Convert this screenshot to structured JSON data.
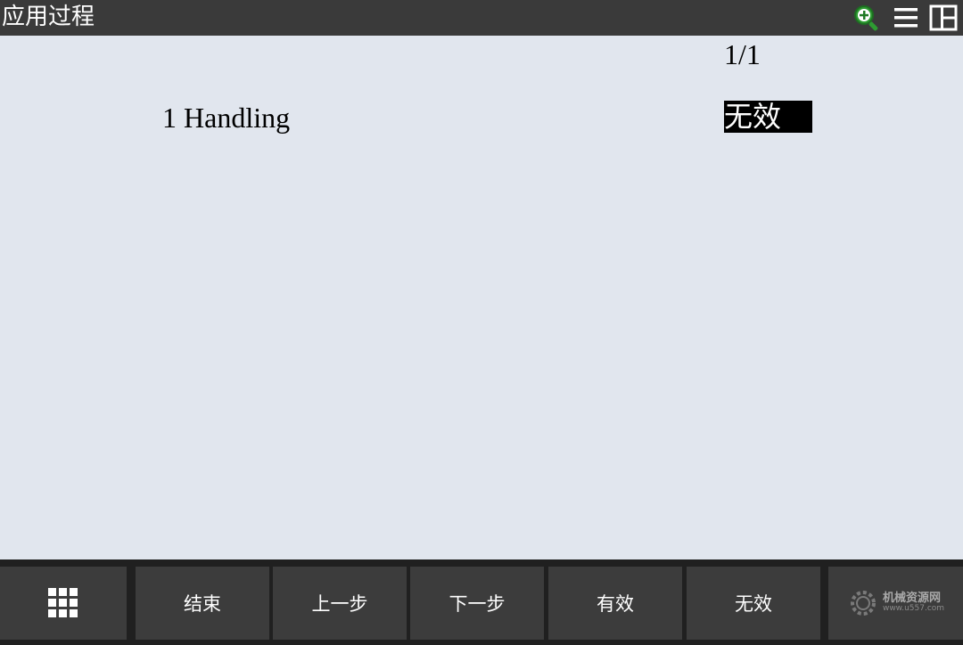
{
  "header": {
    "title": "应用过程",
    "icons": [
      "zoom-in-icon",
      "menu-icon",
      "window-layout-icon"
    ]
  },
  "list": {
    "page_indicator": "1/1",
    "items": [
      {
        "number": "1",
        "name": "Handling",
        "status": "无效"
      }
    ]
  },
  "function_keys": {
    "grid_icon": "app-grid-icon",
    "f1": "结束",
    "f2": "上一步",
    "f3": "下一步",
    "f4": "有效",
    "f5": "无效",
    "watermark_title": "机械资源网",
    "watermark_url": "www.u557.com"
  },
  "colors": {
    "titlebar": "#3a3a3a",
    "content_bg": "#e1e6ee",
    "selection_bg": "#000000",
    "key_bg": "#3c3c3c",
    "zoom_icon_green": "#2e9b32"
  }
}
